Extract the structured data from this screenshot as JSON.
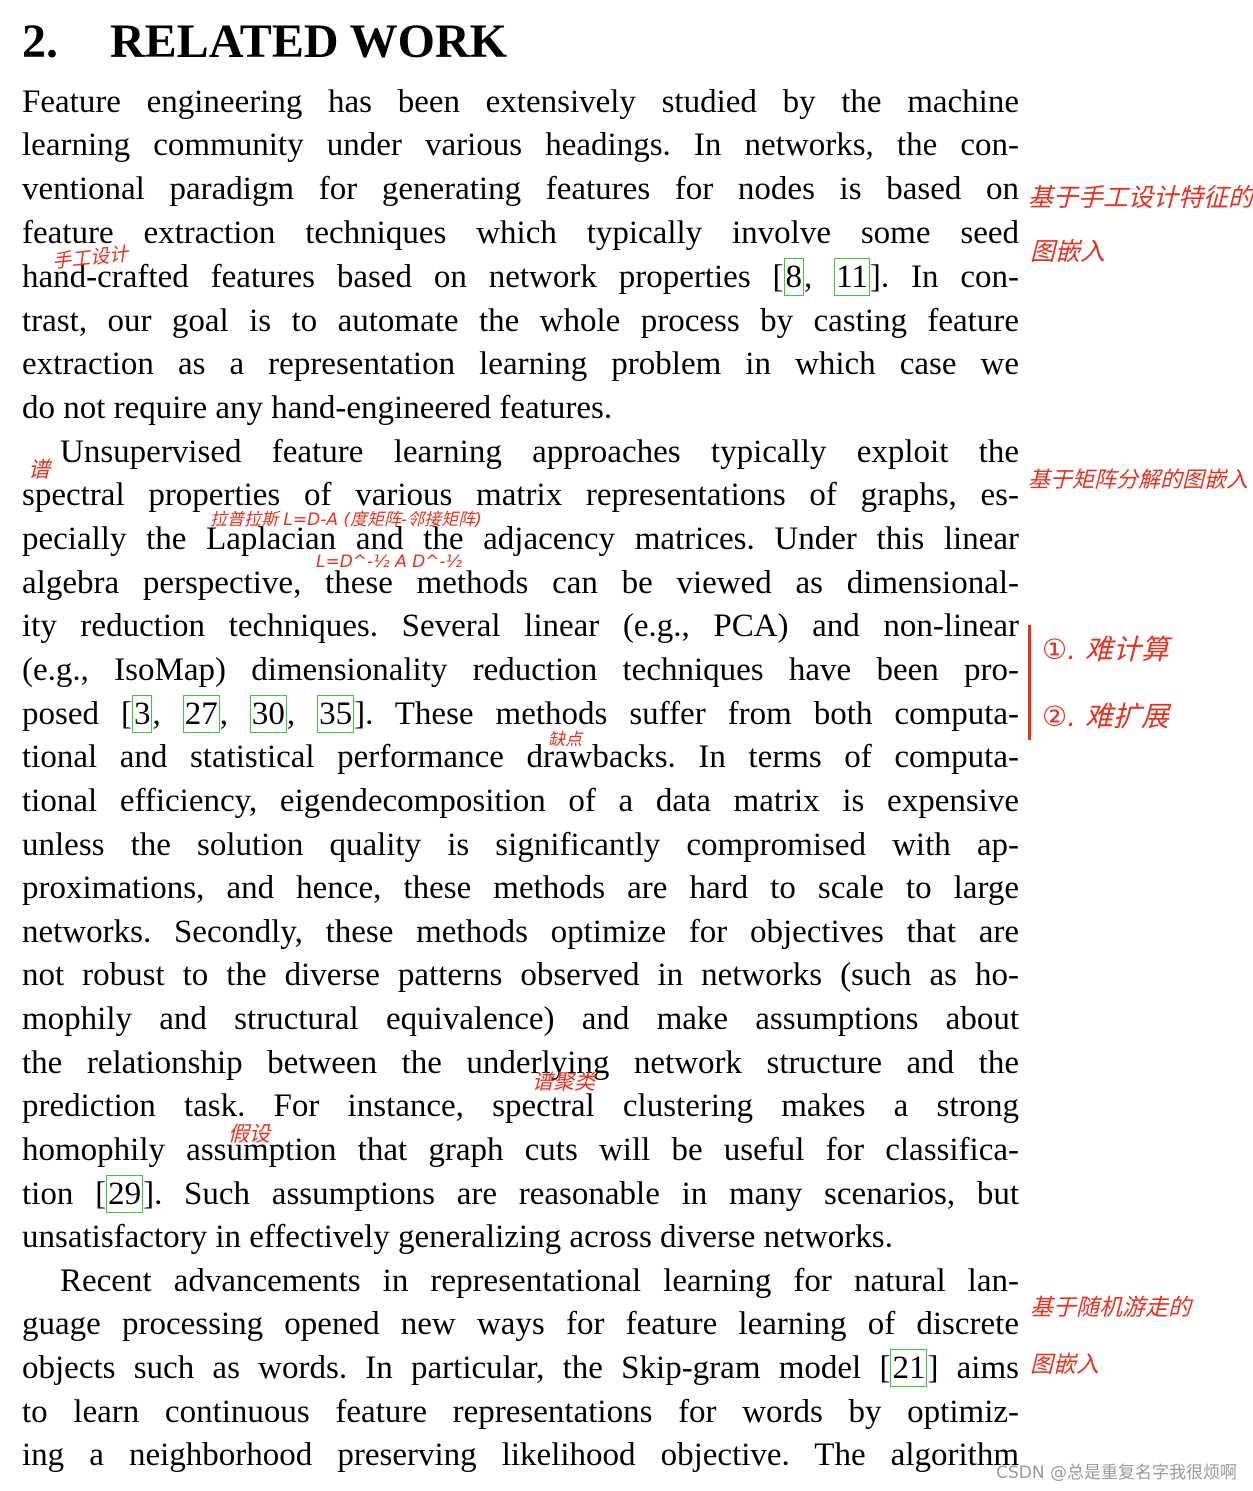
{
  "heading": {
    "number": "2.",
    "title": "RELATED WORK"
  },
  "lines": [
    {
      "segments": [
        {
          "t": "Feature engineering has been extensively studied by the machine"
        }
      ]
    },
    {
      "segments": [
        {
          "t": "learning community under various headings. In networks, the con-"
        }
      ]
    },
    {
      "segments": [
        {
          "t": "ventional paradigm for generating features for nodes is based on"
        }
      ]
    },
    {
      "segments": [
        {
          "t": "feature extraction techniques which typically involve some seed"
        }
      ]
    },
    {
      "segments": [
        {
          "t": "hand-crafted features based on network properties ["
        },
        {
          "t": "8",
          "c": true
        },
        {
          "t": ", "
        },
        {
          "t": "11",
          "c": true
        },
        {
          "t": "]. In con-"
        }
      ]
    },
    {
      "segments": [
        {
          "t": "trast, our goal is to automate the whole process by casting feature"
        }
      ]
    },
    {
      "segments": [
        {
          "t": "extraction as a representation learning problem in which case we"
        }
      ]
    },
    {
      "segments": [
        {
          "t": "do not require any hand-engineered features."
        }
      ],
      "last": true
    },
    {
      "segments": [
        {
          "t": "Unsupervised feature learning approaches typically exploit the"
        }
      ],
      "indent": true
    },
    {
      "segments": [
        {
          "t": "spectral properties of various matrix representations of graphs, es-"
        }
      ]
    },
    {
      "segments": [
        {
          "t": "pecially the Laplacian and the adjacency matrices. Under this linear"
        }
      ]
    },
    {
      "segments": [
        {
          "t": "algebra perspective, these methods can be viewed as dimensional-"
        }
      ]
    },
    {
      "segments": [
        {
          "t": "ity reduction techniques. Several linear (e.g., PCA) and non-linear"
        }
      ]
    },
    {
      "segments": [
        {
          "t": "(e.g., IsoMap) dimensionality reduction techniques have been pro-"
        }
      ]
    },
    {
      "segments": [
        {
          "t": "posed ["
        },
        {
          "t": "3",
          "c": true
        },
        {
          "t": ", "
        },
        {
          "t": "27",
          "c": true
        },
        {
          "t": ", "
        },
        {
          "t": "30",
          "c": true
        },
        {
          "t": ", "
        },
        {
          "t": "35",
          "c": true
        },
        {
          "t": "]. These methods suffer from both computa-"
        }
      ]
    },
    {
      "segments": [
        {
          "t": "tional and statistical performance drawbacks. In terms of computa-"
        }
      ]
    },
    {
      "segments": [
        {
          "t": "tional efficiency, eigendecomposition of a data matrix is expensive"
        }
      ]
    },
    {
      "segments": [
        {
          "t": "unless the solution quality is significantly compromised with ap-"
        }
      ]
    },
    {
      "segments": [
        {
          "t": "proximations, and hence, these methods are hard to scale to large"
        }
      ]
    },
    {
      "segments": [
        {
          "t": "networks. Secondly, these methods optimize for objectives that are"
        }
      ]
    },
    {
      "segments": [
        {
          "t": "not robust to the diverse patterns observed in networks (such as ho-"
        }
      ]
    },
    {
      "segments": [
        {
          "t": "mophily and structural equivalence) and make assumptions about"
        }
      ]
    },
    {
      "segments": [
        {
          "t": "the relationship between the underlying network structure and the"
        }
      ]
    },
    {
      "segments": [
        {
          "t": "prediction task. For instance, spectral clustering makes a strong"
        }
      ]
    },
    {
      "segments": [
        {
          "t": "homophily assumption that graph cuts will be useful for classifica-"
        }
      ]
    },
    {
      "segments": [
        {
          "t": "tion ["
        },
        {
          "t": "29",
          "c": true
        },
        {
          "t": "]. Such assumptions are reasonable in many scenarios, but"
        }
      ]
    },
    {
      "segments": [
        {
          "t": "unsatisfactory in effectively generalizing across diverse networks."
        }
      ],
      "last": true
    },
    {
      "segments": [
        {
          "t": "Recent advancements in representational learning for natural lan-"
        }
      ],
      "indent": true
    },
    {
      "segments": [
        {
          "t": "guage processing opened new ways for feature learning of discrete"
        }
      ]
    },
    {
      "segments": [
        {
          "t": "objects such as words. In particular, the Skip-gram model ["
        },
        {
          "t": "21",
          "c": true
        },
        {
          "t": "] aims"
        }
      ]
    },
    {
      "segments": [
        {
          "t": "to learn continuous feature representations for words by optimiz-"
        }
      ]
    },
    {
      "segments": [
        {
          "t": "ing a neighborhood preserving likelihood objective. The algorithm"
        }
      ]
    }
  ],
  "annotations": {
    "margin_1_line1": "基于手工设计特征的",
    "margin_1_line2": "图嵌入",
    "handcrafted_note": "手工设计",
    "spectral_mark": "谱",
    "margin_2": "基于矩阵分解的图嵌入",
    "laplacian_formula_1": "拉普拉斯 L=D-A (度矩阵-邻接矩阵)",
    "laplacian_formula_2": "L=D^-½ A D^-½",
    "drawbacks_note": "缺点",
    "margin_3_line1": "①. 难计算",
    "margin_3_line2": "②. 难扩展",
    "spectral_clustering_note": "谱聚类",
    "assumption_note": "假设",
    "margin_4_line1": "基于随机游走的",
    "margin_4_line2": "图嵌入"
  },
  "watermark": "CSDN @总是重复名字我很烦啊"
}
